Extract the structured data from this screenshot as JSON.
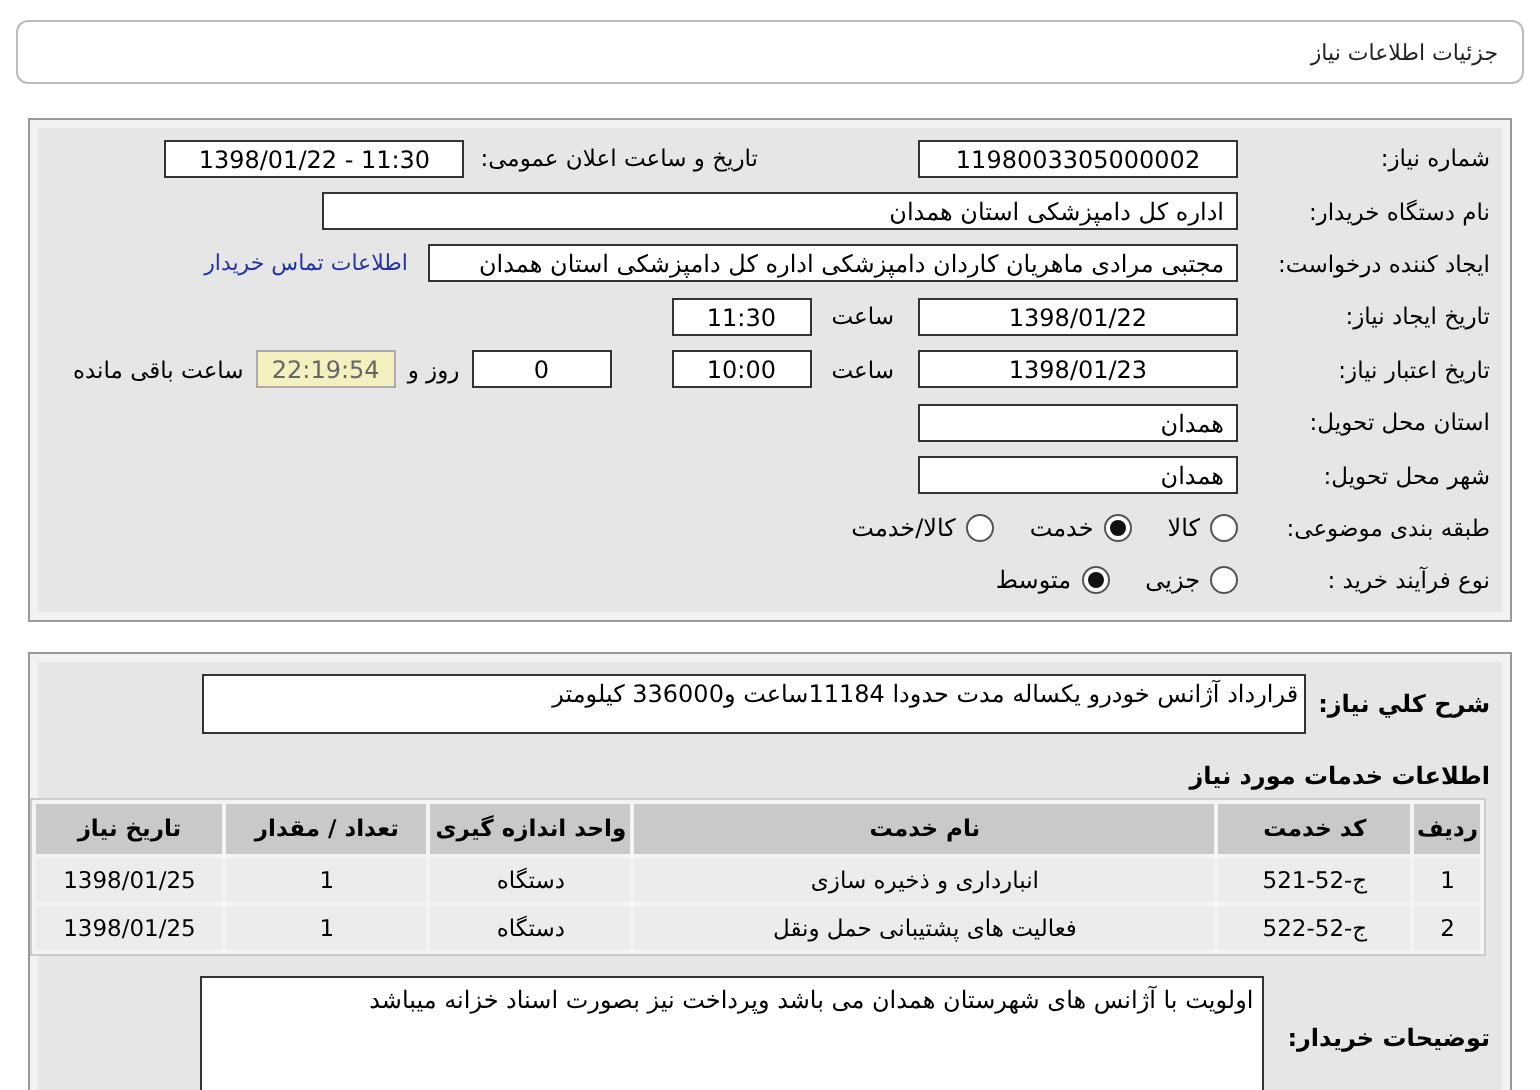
{
  "page_title": "جزئیات اطلاعات نیاز",
  "need_number": {
    "label": "شماره نیاز:",
    "value": "1198003305000002"
  },
  "announce": {
    "label": "تاریخ و ساعت اعلان عمومی:",
    "value": "1398/01/22 - 11:30"
  },
  "buyer_org": {
    "label": "نام دستگاه خریدار:",
    "value": "اداره کل دامپزشکی استان همدان"
  },
  "requester": {
    "label": "ایجاد کننده درخواست:",
    "value": "مجتبی مرادی ماهریان کاردان دامپزشکی اداره کل دامپزشکی استان همدان",
    "link": "اطلاعات تماس خریدار"
  },
  "created": {
    "label": "تاریخ ایجاد نیاز:",
    "date": "1398/01/22",
    "time_label": "ساعت",
    "time": "11:30"
  },
  "validity": {
    "label": "تاریخ اعتبار نیاز:",
    "date": "1398/01/23",
    "time_label": "ساعت",
    "time": "10:00",
    "days": "0",
    "days_label": "روز و",
    "remaining": "22:19:54",
    "remaining_label": "ساعت باقی مانده"
  },
  "province": {
    "label": "استان محل تحویل:",
    "value": "همدان"
  },
  "city": {
    "label": "شهر محل تحویل:",
    "value": "همدان"
  },
  "category": {
    "label": "طبقه بندی موضوعی:",
    "options": [
      {
        "label": "کالا",
        "selected": false
      },
      {
        "label": "خدمت",
        "selected": true
      },
      {
        "label": "کالا/خدمت",
        "selected": false
      }
    ]
  },
  "process": {
    "label": "نوع فرآیند خرید :",
    "options": [
      {
        "label": "جزیی",
        "selected": false
      },
      {
        "label": "متوسط",
        "selected": true
      }
    ]
  },
  "description": {
    "label": "شرح کلي نياز:",
    "text": "قرارداد آژانس خودرو یکساله مدت حدودا 11184ساعت و336000 کیلومتر"
  },
  "services": {
    "title": "اطلاعات خدمات مورد نیاز",
    "columns": [
      "ردیف",
      "کد خدمت",
      "نام خدمت",
      "واحد اندازه گیری",
      "تعداد / مقدار",
      "تاریخ نیاز"
    ],
    "rows": [
      [
        "1",
        "ج-52-521",
        "انبارداری و ذخیره سازی",
        "دستگاه",
        "1",
        "1398/01/25"
      ],
      [
        "2",
        "ج-52-522",
        "فعالیت های پشتیبانی حمل ونقل",
        "دستگاه",
        "1",
        "1398/01/25"
      ]
    ]
  },
  "buyer_notes": {
    "label": "توضیحات خریدار:",
    "text": "اولویت با آژانس های شهرستان همدان می باشد وپرداخت نیز بصورت اسناد خزانه میباشد"
  }
}
